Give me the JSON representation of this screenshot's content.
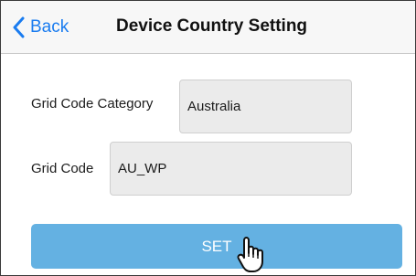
{
  "header": {
    "back_label": "Back",
    "title": "Device Country Setting"
  },
  "form": {
    "grid_code_category": {
      "label": "Grid Code Category",
      "value": "Australia"
    },
    "grid_code": {
      "label": "Grid Code",
      "value": "AU_WP"
    },
    "set_label": "SET"
  },
  "icons": {
    "back": "chevron-left-icon",
    "cursor": "pointing-hand-icon"
  },
  "colors": {
    "accent": "#1a7cf0",
    "button": "#64b1e2",
    "field_bg": "#ebebeb"
  }
}
